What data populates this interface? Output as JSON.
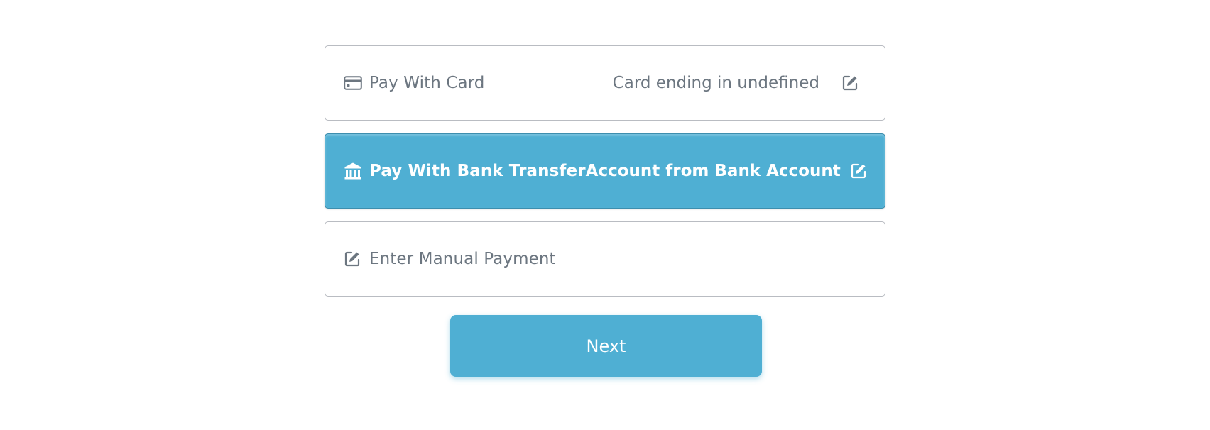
{
  "payment_options": [
    {
      "label": "Pay With Card",
      "detail": "Card ending in undefined",
      "icon": "credit-card-icon",
      "selected": false
    },
    {
      "label": "Pay With Bank Transfer",
      "detail": "Account from Bank Account",
      "icon": "bank-icon",
      "selected": true
    },
    {
      "label": "Enter Manual Payment",
      "icon": "edit-icon",
      "selected": false
    }
  ],
  "next_button": {
    "label": "Next"
  },
  "colors": {
    "accent": "#4fafd3",
    "text_muted": "#6c7680",
    "border": "#b9bcc2"
  }
}
